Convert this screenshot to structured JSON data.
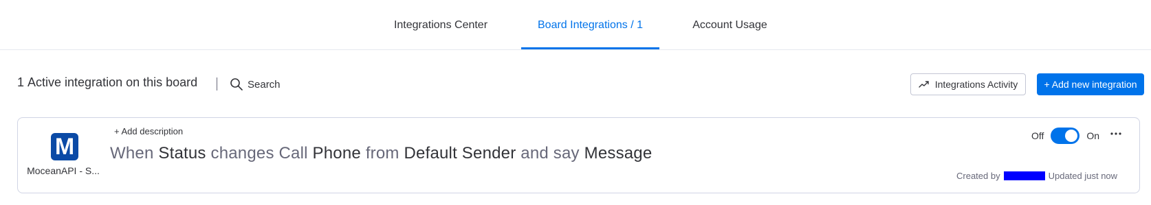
{
  "tabs": [
    {
      "label": "Integrations Center",
      "active": false
    },
    {
      "label": "Board Integrations / 1",
      "active": true
    },
    {
      "label": "Account Usage",
      "active": false
    }
  ],
  "toolbar": {
    "count": "1",
    "summary_text": "Active integration on this board",
    "search_label": "Search",
    "activity_button": "Integrations Activity",
    "add_button": "+ Add new integration"
  },
  "integration": {
    "app_initial": "M",
    "app_name": "MoceanAPI - S...",
    "add_description": "+ Add description",
    "recipe": {
      "w1": "When",
      "f1": "Status",
      "w2": "changes Call",
      "f2": "Phone",
      "w3": "from",
      "f3": "Default Sender",
      "w4": "and say",
      "f4": "Message"
    },
    "toggle": {
      "off_label": "Off",
      "on_label": "On",
      "state": "on"
    },
    "created_by_label": "Created by",
    "updated_label": "Updated just now"
  },
  "colors": {
    "accent": "#0073ea",
    "logo_bg": "#0b4aa6",
    "redaction": "#0000ff"
  },
  "icons": [
    "search-icon",
    "activity-icon",
    "more-icon"
  ]
}
